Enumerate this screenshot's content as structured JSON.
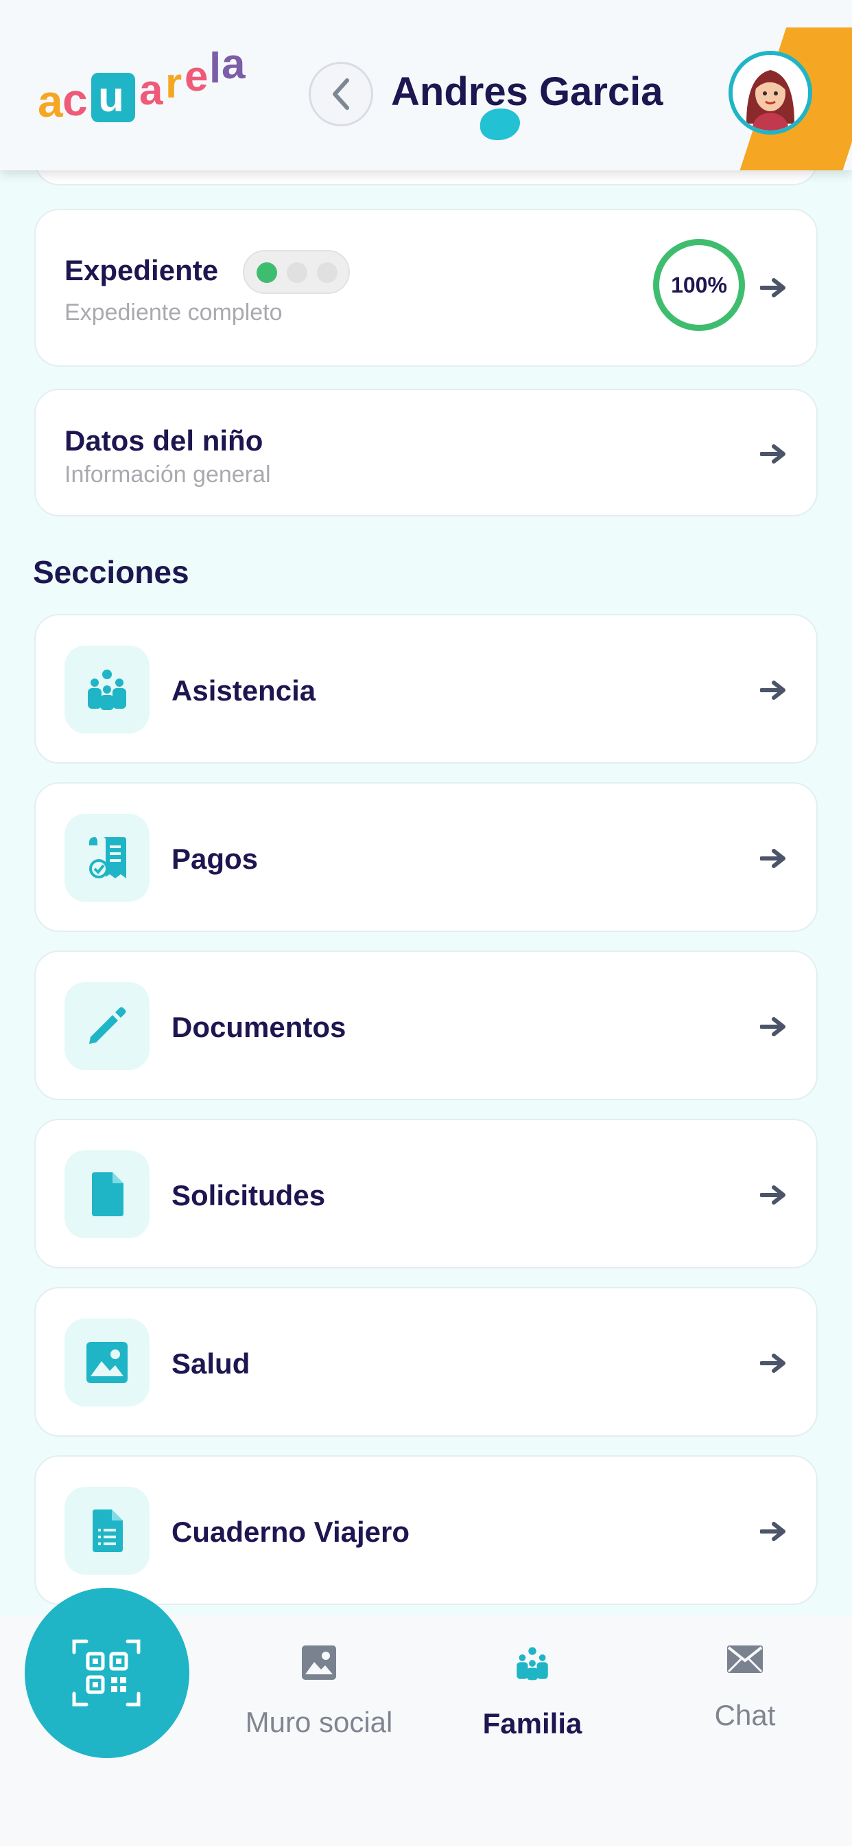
{
  "app": {
    "logo_text": "acuarela"
  },
  "header": {
    "title": "Andres Garcia",
    "back_icon": "chevron-left-icon",
    "avatar": "user-avatar"
  },
  "expediente": {
    "title": "Expediente",
    "subtitle": "Expediente completo",
    "progress_label": "100%",
    "progress_value": 1.0,
    "toggle_steps": 3,
    "toggle_active_step": 1
  },
  "datos_nino": {
    "title": "Datos del niño",
    "subtitle": "Información general"
  },
  "sections": {
    "heading": "Secciones",
    "items": [
      {
        "label": "Asistencia",
        "icon": "family-group-icon"
      },
      {
        "label": "Pagos",
        "icon": "receipt-check-icon"
      },
      {
        "label": "Documentos",
        "icon": "pencil-icon"
      },
      {
        "label": "Solicitudes",
        "icon": "file-icon"
      },
      {
        "label": "Salud",
        "icon": "image-icon"
      },
      {
        "label": "Cuaderno Viajero",
        "icon": "document-list-icon"
      }
    ]
  },
  "bottom_nav": {
    "qr_icon": "qr-code-icon",
    "items": [
      {
        "label": "Muro social",
        "icon": "image-icon",
        "active": false
      },
      {
        "label": "Familia",
        "icon": "family-group-icon",
        "active": true
      },
      {
        "label": "Chat",
        "icon": "envelope-icon",
        "active": false
      }
    ]
  },
  "colors": {
    "accent": "#1fb5c6",
    "success": "#3fbd6f",
    "title": "#1d1650",
    "background": "#eefcfc",
    "header_deco": "#f5a623"
  }
}
